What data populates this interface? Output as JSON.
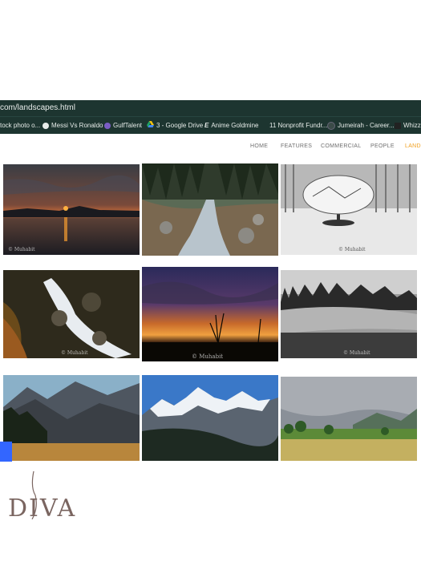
{
  "browser": {
    "url": "com/landscapes.html",
    "bookmarks": [
      {
        "label": "tock photo o...",
        "icon": "none"
      },
      {
        "label": "Messi Vs Ronaldo",
        "icon": "globe-icon"
      },
      {
        "label": "GulfTalent",
        "icon": "gulftalent-icon"
      },
      {
        "label": "3 - Google Drive",
        "icon": "google-drive-icon"
      },
      {
        "label": "Anime Goldmine",
        "icon": "anime-goldmine-icon"
      },
      {
        "label": "11 Nonprofit Fundr...",
        "icon": "none"
      },
      {
        "label": "Jumeirah - Career...",
        "icon": "jumeirah-icon"
      },
      {
        "label": "Whizz",
        "icon": "whizz-icon"
      }
    ]
  },
  "nav": {
    "items": [
      "HOME",
      "FEATURES",
      "COMMERCIAL",
      "PEOPLE",
      "LAND"
    ],
    "active_color": "#f0a020"
  },
  "gallery": {
    "watermark": "© Muhabit",
    "photos": [
      {
        "name": "sunset-lake"
      },
      {
        "name": "forest-stream"
      },
      {
        "name": "snow-tree"
      },
      {
        "name": "rocky-stream"
      },
      {
        "name": "dusk-sky"
      },
      {
        "name": "bw-meadow"
      },
      {
        "name": "mountain-valley"
      },
      {
        "name": "snow-mountains"
      },
      {
        "name": "green-field"
      }
    ]
  },
  "logo": {
    "text": "DIVA",
    "color": "#7a6560"
  }
}
